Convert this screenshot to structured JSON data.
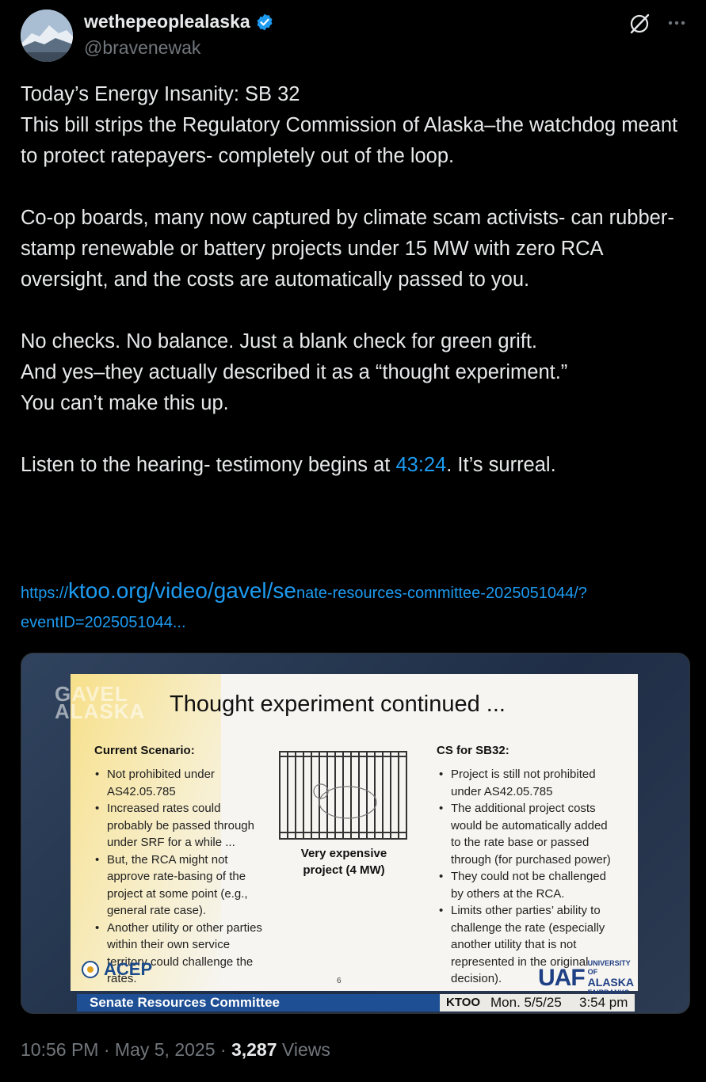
{
  "author": {
    "display_name": "wethepeoplealaska",
    "handle": "@bravenewak",
    "verified": true,
    "avatar_icon": "mountain-landscape-avatar"
  },
  "header_icons": {
    "grok": "grok-icon",
    "more": "more-icon"
  },
  "tweet": {
    "p1": "Today’s Energy Insanity: SB 32\nThis bill strips the Regulatory Commission of Alaska–the watchdog meant to protect ratepayers- completely out of the loop.",
    "p2": "Co-op boards, many now captured by climate scam activists- can rubber-stamp renewable or battery projects under 15 MW with zero RCA oversight, and the costs are automatically passed to you.",
    "p3": "No checks. No balance. Just a blank check for green grift.\nAnd yes–they actually described it as a “thought experiment.”\nYou can’t make this up.",
    "p4_before": "Listen to the hearing- testimony begins at ",
    "p4_timestamp": "43:24",
    "p4_after": ". It’s surreal."
  },
  "link": {
    "prefix": "https://",
    "big": "ktoo.org/video/gavel/se",
    "rest": "nate-resources-committee-2025051044/?eventID=2025051044..."
  },
  "media": {
    "watermark": "GAVEL ALASKA",
    "slide": {
      "title": "Thought experiment continued ...",
      "left_heading": "Current Scenario:",
      "left_items": [
        "Not prohibited under AS42.05.785",
        "Increased rates could probably be passed through under SRF for a while ...",
        "But, the RCA might not approve rate-basing of the project at some point (e.g., general rate case).",
        "Another utility or other parties within their own service territory could challenge the rates."
      ],
      "center_caption": "Very expensive project (4 MW)",
      "right_heading": "CS for SB32:",
      "right_items": [
        "Project is still not prohibited under AS42.05.785",
        "The additional project costs would be automatically added to the rate base or passed through (for purchased power)",
        "They could not be challenged by others at the RCA.",
        "Limits other parties’ ability to challenge the rate (especially another utility that is not represented in the original decision)."
      ],
      "page_number": "6",
      "acep_logo": "ACEP",
      "uaf_logo": "UAF",
      "uaf_sub1": "UNIVERSITY OF",
      "uaf_sub2": "ALASKA",
      "uaf_sub3": "FAIRBANKS"
    },
    "lower_third": {
      "committee": "Senate Resources Committee",
      "station": "KTOO",
      "date": "Mon. 5/5/25",
      "time": "3:54 pm"
    }
  },
  "meta": {
    "time": "10:56 PM",
    "sep1": " · ",
    "date": "May 5, 2025",
    "sep2": " · ",
    "views_count": "3,287",
    "views_label": " Views"
  },
  "colors": {
    "accent": "#1d9bf0",
    "text": "#e7e9ea",
    "muted": "#71767b",
    "bg": "#000000"
  }
}
